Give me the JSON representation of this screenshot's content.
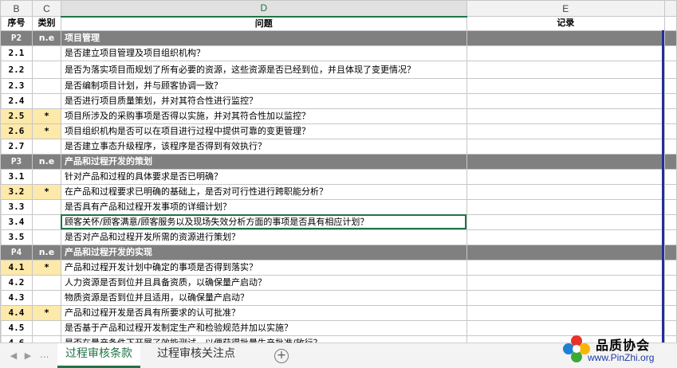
{
  "column_headers": {
    "B": "B",
    "C": "C",
    "D": "D",
    "E": "E"
  },
  "field_headers": {
    "no": "序号",
    "category": "类别",
    "question": "问题",
    "record": "记录"
  },
  "rows": [
    {
      "type": "section",
      "no": "P2",
      "cat": "n.e",
      "text": "项目管理"
    },
    {
      "type": "item",
      "no": "2.1",
      "cat": "",
      "text": "是否建立项目管理及项目组织机构？"
    },
    {
      "type": "item",
      "no": "2.2",
      "cat": "",
      "text": "是否为落实项目而规划了所有必要的资源，这些资源是否已经到位，并且体现了变更情况？",
      "tall": true
    },
    {
      "type": "item",
      "no": "2.3",
      "cat": "",
      "text": "是否编制项目计划，并与顾客协调一致？"
    },
    {
      "type": "item",
      "no": "2.4",
      "cat": "",
      "text": "是否进行项目质量策划，并对其符合性进行监控？"
    },
    {
      "type": "item",
      "no": "2.5",
      "cat": "*",
      "text": "项目所涉及的采购事项是否得以实施，并对其符合性加以监控？",
      "star": true
    },
    {
      "type": "item",
      "no": "2.6",
      "cat": "*",
      "text": "项目组织机构是否可以在项目进行过程中提供可靠的变更管理？",
      "star": true
    },
    {
      "type": "item",
      "no": "2.7",
      "cat": "",
      "text": "是否建立事态升级程序，该程序是否得到有效执行？"
    },
    {
      "type": "section",
      "no": "P3",
      "cat": "n.e",
      "text": "产品和过程开发的策划"
    },
    {
      "type": "item",
      "no": "3.1",
      "cat": "",
      "text": "针对产品和过程的具体要求是否已明确？"
    },
    {
      "type": "item",
      "no": "3.2",
      "cat": "*",
      "text": "在产品和过程要求已明确的基础上，是否对可行性进行跨职能分析？",
      "star": true
    },
    {
      "type": "item",
      "no": "3.3",
      "cat": "",
      "text": "是否具有产品和过程开发事项的详细计划？"
    },
    {
      "type": "item",
      "no": "3.4",
      "cat": "",
      "text": "顾客关怀/顾客满意/顾客服务以及现场失效分析方面的事项是否具有相应计划？",
      "active": true
    },
    {
      "type": "item",
      "no": "3.5",
      "cat": "",
      "text": "是否对产品和过程开发所需的资源进行策划？"
    },
    {
      "type": "section",
      "no": "P4",
      "cat": "n.e",
      "text": "产品和过程开发的实现"
    },
    {
      "type": "item",
      "no": "4.1",
      "cat": "*",
      "text": "产品和过程开发计划中确定的事项是否得到落实？",
      "star": true
    },
    {
      "type": "item",
      "no": "4.2",
      "cat": "",
      "text": "人力资源是否到位并且具备资质，以确保量产启动？"
    },
    {
      "type": "item",
      "no": "4.3",
      "cat": "",
      "text": "物质资源是否到位并且适用，以确保量产启动？"
    },
    {
      "type": "item",
      "no": "4.4",
      "cat": "*",
      "text": "产品和过程开发是否具有所要求的认可批准？",
      "star": true
    },
    {
      "type": "item",
      "no": "4.5",
      "cat": "",
      "text": "是否基于产品和过程开发制定生产和检验规范并加以实施？"
    },
    {
      "type": "item",
      "no": "4.6",
      "cat": "",
      "text": "是否在量产条件下开展了效能测试，以便获得批量生产批准/放行？"
    }
  ],
  "sheet_tabs": [
    {
      "label": "过程审核条款",
      "active": true
    },
    {
      "label": "过程审核关注点",
      "active": false
    }
  ],
  "nav": {
    "prev": "◀",
    "next": "▶",
    "more": "...",
    "add": "+"
  },
  "watermark": {
    "title": "品质协会",
    "url": "www.PinZhi.org"
  },
  "colors": {
    "section_bg": "#808080",
    "star_bg": "#fde9a9",
    "accent": "#217346",
    "border_blue": "#1f2f9a"
  }
}
